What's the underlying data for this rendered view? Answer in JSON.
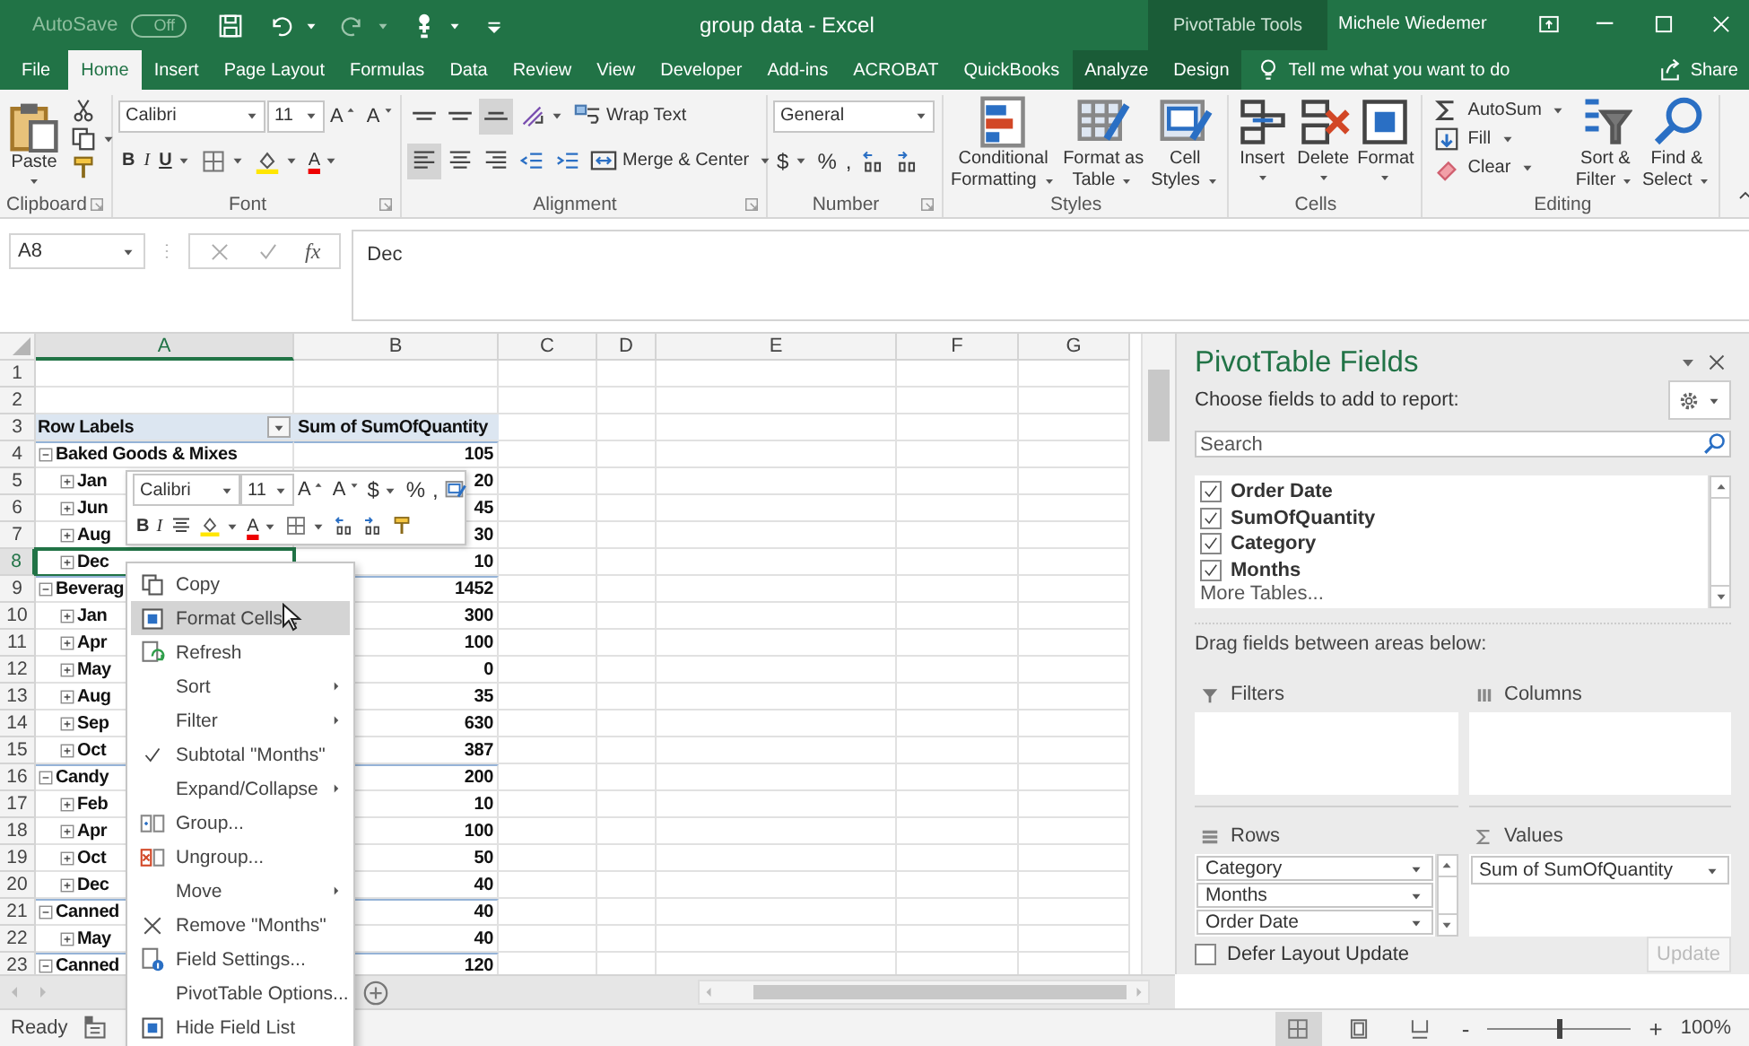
{
  "title_bar": {
    "autosave_label": "AutoSave",
    "autosave_state": "Off",
    "document_title": "group data  -  Excel",
    "contextual_group": "PivotTable Tools",
    "user": "Michele Wiedemer"
  },
  "ribbon_tabs": [
    {
      "label": "File",
      "selected": false,
      "kind": "normal"
    },
    {
      "label": "Home",
      "selected": true,
      "kind": "normal"
    },
    {
      "label": "Insert",
      "selected": false,
      "kind": "normal"
    },
    {
      "label": "Page Layout",
      "selected": false,
      "kind": "normal"
    },
    {
      "label": "Formulas",
      "selected": false,
      "kind": "normal"
    },
    {
      "label": "Data",
      "selected": false,
      "kind": "normal"
    },
    {
      "label": "Review",
      "selected": false,
      "kind": "normal"
    },
    {
      "label": "View",
      "selected": false,
      "kind": "normal"
    },
    {
      "label": "Developer",
      "selected": false,
      "kind": "normal"
    },
    {
      "label": "Add-ins",
      "selected": false,
      "kind": "normal"
    },
    {
      "label": "ACROBAT",
      "selected": false,
      "kind": "normal"
    },
    {
      "label": "QuickBooks",
      "selected": false,
      "kind": "normal"
    },
    {
      "label": "Analyze",
      "selected": false,
      "kind": "contextual"
    },
    {
      "label": "Design",
      "selected": false,
      "kind": "contextual"
    }
  ],
  "tell_me": "Tell me what you want to do",
  "share": "Share",
  "ribbon": {
    "clipboard": {
      "paste": "Paste",
      "label": "Clipboard"
    },
    "font": {
      "name": "Calibri",
      "size": "11",
      "label": "Font",
      "row1": [
        {
          "kind": "grow",
          "text": "A"
        },
        {
          "kind": "shrink",
          "text": "A"
        }
      ],
      "row2": [
        {
          "kind": "bold",
          "text": "B"
        },
        {
          "kind": "italic",
          "text": "I"
        },
        {
          "kind": "underline",
          "text": "U",
          "dropdown": true
        },
        {
          "kind": "borders",
          "dropdown": true
        },
        {
          "kind": "fill",
          "dropdown": true
        },
        {
          "kind": "font-color",
          "text": "A",
          "dropdown": true
        }
      ]
    },
    "alignment": {
      "label": "Alignment",
      "wrap": "Wrap Text",
      "merge": "Merge & Center",
      "vertical": [
        {
          "kind": "top",
          "selected": false
        },
        {
          "kind": "middle",
          "selected": false
        },
        {
          "kind": "bottom",
          "selected": true
        }
      ],
      "horizontal": [
        {
          "kind": "left",
          "selected": true
        },
        {
          "kind": "center",
          "selected": false
        },
        {
          "kind": "right",
          "selected": false
        }
      ]
    },
    "number": {
      "label": "Number",
      "format": "General",
      "tools": [
        {
          "kind": "currency",
          "text": "$",
          "dropdown": true
        },
        {
          "kind": "percent",
          "text": "%"
        },
        {
          "kind": "comma",
          "text": ","
        },
        {
          "kind": "inc-decimal"
        },
        {
          "kind": "dec-decimal"
        }
      ]
    },
    "styles": {
      "label": "Styles",
      "buttons": [
        {
          "kind": "conditional",
          "lines": [
            "Conditional",
            "Formatting"
          ]
        },
        {
          "kind": "table",
          "lines": [
            "Format as",
            "Table"
          ]
        },
        {
          "kind": "cell-styles",
          "lines": [
            "Cell",
            "Styles"
          ]
        }
      ]
    },
    "cells": {
      "label": "Cells",
      "buttons": [
        {
          "kind": "insert",
          "lines": [
            "Insert"
          ]
        },
        {
          "kind": "delete",
          "lines": [
            "Delete"
          ]
        },
        {
          "kind": "format",
          "lines": [
            "Format"
          ]
        }
      ]
    },
    "editing": {
      "label": "Editing",
      "autosum": "AutoSum",
      "fill": "Fill",
      "clear": "Clear",
      "buttons": [
        {
          "kind": "sort-filter",
          "lines": [
            "Sort &",
            "Filter"
          ]
        },
        {
          "kind": "find",
          "lines": [
            "Find &",
            "Select"
          ]
        }
      ]
    }
  },
  "formula_bar": {
    "name_box": "A8",
    "function_label": "fx",
    "value": "Dec"
  },
  "sheet": {
    "columns": [
      {
        "label": "A",
        "selected": true
      },
      {
        "label": "B",
        "selected": false
      },
      {
        "label": "C",
        "selected": false
      },
      {
        "label": "D",
        "selected": false
      },
      {
        "label": "E",
        "selected": false
      },
      {
        "label": "F",
        "selected": false
      },
      {
        "label": "G",
        "selected": false
      }
    ],
    "rows": [
      {
        "number": "1",
        "kind": "blank",
        "selected": false
      },
      {
        "number": "2",
        "kind": "blank",
        "selected": false
      },
      {
        "number": "3",
        "kind": "header",
        "label": "Row Labels",
        "value": "Sum of SumOfQuantity",
        "selected": false
      },
      {
        "number": "4",
        "kind": "category",
        "label": "Baked Goods & Mixes",
        "value": "105",
        "selected": false
      },
      {
        "number": "5",
        "kind": "item",
        "label": "Jan",
        "value": "20",
        "selected": false
      },
      {
        "number": "6",
        "kind": "item",
        "label": "Jun",
        "value": "45",
        "selected": false
      },
      {
        "number": "7",
        "kind": "item",
        "label": "Aug",
        "value": "30",
        "selected": false
      },
      {
        "number": "8",
        "kind": "item",
        "label": "Dec",
        "value": "10",
        "selected": true
      },
      {
        "number": "9",
        "kind": "category",
        "label": "Beverag",
        "value": "1452",
        "selected": false
      },
      {
        "number": "10",
        "kind": "item",
        "label": "Jan",
        "value": "300",
        "selected": false
      },
      {
        "number": "11",
        "kind": "item",
        "label": "Apr",
        "value": "100",
        "selected": false
      },
      {
        "number": "12",
        "kind": "item",
        "label": "May",
        "value": "0",
        "selected": false
      },
      {
        "number": "13",
        "kind": "item",
        "label": "Aug",
        "value": "35",
        "selected": false
      },
      {
        "number": "14",
        "kind": "item",
        "label": "Sep",
        "value": "630",
        "selected": false
      },
      {
        "number": "15",
        "kind": "item",
        "label": "Oct",
        "value": "387",
        "selected": false
      },
      {
        "number": "16",
        "kind": "category",
        "label": "Candy",
        "value": "200",
        "selected": false
      },
      {
        "number": "17",
        "kind": "item",
        "label": "Feb",
        "value": "10",
        "selected": false
      },
      {
        "number": "18",
        "kind": "item",
        "label": "Apr",
        "value": "100",
        "selected": false
      },
      {
        "number": "19",
        "kind": "item",
        "label": "Oct",
        "value": "50",
        "selected": false
      },
      {
        "number": "20",
        "kind": "item",
        "label": "Dec",
        "value": "40",
        "selected": false
      },
      {
        "number": "21",
        "kind": "category",
        "label": "Canned",
        "value": "40",
        "selected": false
      },
      {
        "number": "22",
        "kind": "item",
        "label": "May",
        "value": "40",
        "selected": false
      },
      {
        "number": "23",
        "kind": "category",
        "label": "Canned",
        "value": "120",
        "selected": false
      }
    ]
  },
  "mini_toolbar": {
    "font": "Calibri",
    "size": "11",
    "row1": [
      {
        "kind": "grow",
        "text": "A"
      },
      {
        "kind": "shrink",
        "text": "A"
      },
      {
        "kind": "currency",
        "text": "$",
        "dropdown": true
      },
      {
        "kind": "percent",
        "text": "%"
      },
      {
        "kind": "comma",
        "text": ","
      },
      {
        "kind": "styles"
      }
    ],
    "row2": [
      {
        "kind": "bold",
        "text": "B"
      },
      {
        "kind": "italic",
        "text": "I"
      },
      {
        "kind": "center"
      },
      {
        "kind": "fill",
        "dropdown": true
      },
      {
        "kind": "font-color",
        "text": "A",
        "dropdown": true
      },
      {
        "kind": "borders",
        "dropdown": true
      },
      {
        "kind": "inc-decimal"
      },
      {
        "kind": "dec-decimal"
      },
      {
        "kind": "painter"
      }
    ]
  },
  "context_menu": [
    {
      "label": "Copy",
      "kind": "copy",
      "submenu": false,
      "checked": false,
      "selected": false
    },
    {
      "label": "Format Cells...",
      "kind": "format",
      "submenu": false,
      "checked": false,
      "selected": true
    },
    {
      "label": "Refresh",
      "kind": "refresh",
      "submenu": false,
      "checked": false,
      "selected": false
    },
    {
      "label": "Sort",
      "kind": "plain",
      "submenu": true,
      "checked": false,
      "selected": false
    },
    {
      "label": "Filter",
      "kind": "plain",
      "submenu": true,
      "checked": false,
      "selected": false
    },
    {
      "label": "Subtotal \"Months\"",
      "kind": "plain",
      "submenu": false,
      "checked": true,
      "selected": false
    },
    {
      "label": "Expand/Collapse",
      "kind": "plain",
      "submenu": true,
      "checked": false,
      "selected": false
    },
    {
      "label": "Group...",
      "kind": "group",
      "submenu": false,
      "checked": false,
      "selected": false
    },
    {
      "label": "Ungroup...",
      "kind": "ungroup",
      "submenu": false,
      "checked": false,
      "selected": false
    },
    {
      "label": "Move",
      "kind": "plain",
      "submenu": true,
      "checked": false,
      "selected": false
    },
    {
      "label": "Remove \"Months\"",
      "kind": "remove",
      "submenu": false,
      "checked": false,
      "selected": false
    },
    {
      "label": "Field Settings...",
      "kind": "settings",
      "submenu": false,
      "checked": false,
      "selected": false
    },
    {
      "label": "PivotTable Options...",
      "kind": "plain",
      "submenu": false,
      "checked": false,
      "selected": false
    },
    {
      "label": "Hide Field List",
      "kind": "hide",
      "submenu": false,
      "checked": false,
      "selected": false
    }
  ],
  "field_list": {
    "title": "PivotTable Fields",
    "subtitle": "Choose fields to add to report:",
    "search_placeholder": "Search",
    "fields": [
      {
        "label": "Order Date",
        "checked": true
      },
      {
        "label": "SumOfQuantity",
        "checked": true
      },
      {
        "label": "Category",
        "checked": true
      },
      {
        "label": "Months",
        "checked": true
      }
    ],
    "more_tables": "More Tables...",
    "drag_hint": "Drag fields between areas below:",
    "areas": [
      {
        "kind": "filters",
        "label": "Filters"
      },
      {
        "kind": "columns",
        "label": "Columns"
      },
      {
        "kind": "rows",
        "label": "Rows",
        "fields": [
          "Category",
          "Months",
          "Order Date"
        ]
      },
      {
        "kind": "values",
        "label": "Values",
        "fields": [
          "Sum of SumOfQuantity"
        ]
      }
    ],
    "defer": {
      "label": "Defer Layout Update",
      "checked": false
    },
    "update": {
      "label": "Update",
      "disabled": true
    }
  },
  "status_bar": {
    "status": "Ready",
    "zoom": {
      "level": 0.5,
      "reading": "100%",
      "zoom_out": "-",
      "zoom_in": "+"
    }
  }
}
